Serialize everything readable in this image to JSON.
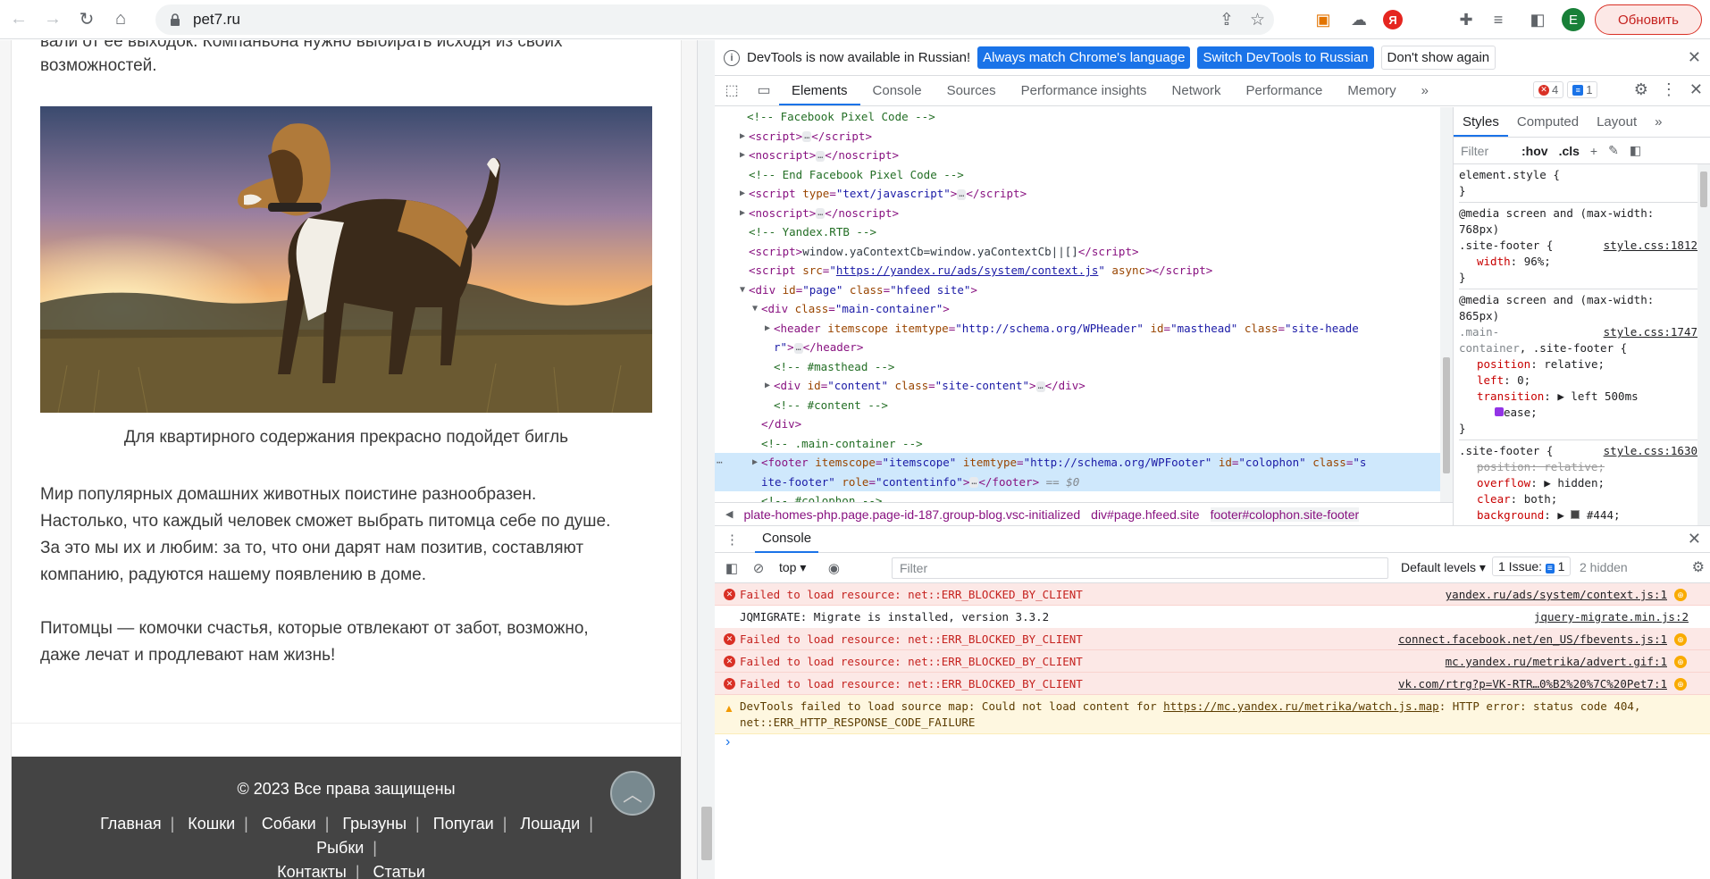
{
  "browser": {
    "url": "pet7.ru",
    "profile_letter": "Е",
    "update_label": "Обновить"
  },
  "page": {
    "top_text_1": "вали от ее выходок. Компаньона нужно выбирать исходя из своих",
    "top_text_2": "возможностей.",
    "caption": "Для квартирного содержания прекрасно подойдет бигль",
    "para1": [
      "Мир популярных домашних животных поистине разнообразен.",
      "Настолько, что каждый человек сможет выбрать питомца себе по душе.",
      "За это мы их и любим: за то, что они дарят нам позитив, составляют",
      "компанию, радуются нашему появлению в доме."
    ],
    "para2": [
      "Питомцы — комочки счастья, которые отвлекают от забот, возможно,",
      "даже лечат и продлевают нам жизнь!"
    ],
    "footer": {
      "copyright": "© 2023 Все права защищены",
      "nav": [
        "Главная",
        "Кошки",
        "Собаки",
        "Грызуны",
        "Попугаи",
        "Лошади",
        "Рыбки",
        "Контакты",
        "Статьи"
      ]
    }
  },
  "devtools": {
    "infobar": {
      "message": "DevTools is now available in Russian!",
      "btn1": "Always match Chrome's language",
      "btn2": "Switch DevTools to Russian",
      "btn3": "Don't show again"
    },
    "tabs": [
      "Elements",
      "Console",
      "Sources",
      "Performance insights",
      "Network",
      "Performance",
      "Memory"
    ],
    "error_count": "4",
    "issue_count": "1",
    "styles_tabs": [
      "Styles",
      "Computed",
      "Layout"
    ],
    "styles_filter": {
      "placeholder": "Filter",
      "hov": ":hov",
      "cls": ".cls"
    },
    "breadcrumb": [
      "plate-homes-php.page.page-id-187.group-blog.vsc-initialized",
      "div#page.hfeed.site",
      "footer#colophon.site-footer"
    ],
    "console": {
      "title": "Console",
      "context": "top",
      "filter_placeholder": "Filter",
      "levels": "Default levels",
      "issues_label": "1 Issue:",
      "issues_count": "1",
      "hidden": "2 hidden",
      "messages": [
        {
          "type": "error",
          "text": "Failed to load resource: net::ERR_BLOCKED_BY_CLIENT",
          "source": "yandex.ru/ads/system/context.js:1"
        },
        {
          "type": "info",
          "text": "JQMIGRATE: Migrate is installed, version 3.3.2",
          "source": "jquery-migrate.min.js:2"
        },
        {
          "type": "error",
          "text": "Failed to load resource: net::ERR_BLOCKED_BY_CLIENT",
          "source": "connect.facebook.net/en_US/fbevents.js:1"
        },
        {
          "type": "error",
          "text": "Failed to load resource: net::ERR_BLOCKED_BY_CLIENT",
          "source": "mc.yandex.ru/metrika/advert.gif:1"
        },
        {
          "type": "error",
          "text": "Failed to load resource: net::ERR_BLOCKED_BY_CLIENT",
          "source": "vk.com/rtrg?p=VK-RTR…0%B2%20%7C%20Pet7:1"
        }
      ],
      "warning": {
        "pre": "DevTools failed to load source map: Could not load content for ",
        "link": "https://mc.yandex.ru/metrika/watch.js.map",
        "post": ": HTTP error: status code 404, net::ERR_HTTP_RESPONSE_CODE_FAILURE"
      }
    }
  }
}
